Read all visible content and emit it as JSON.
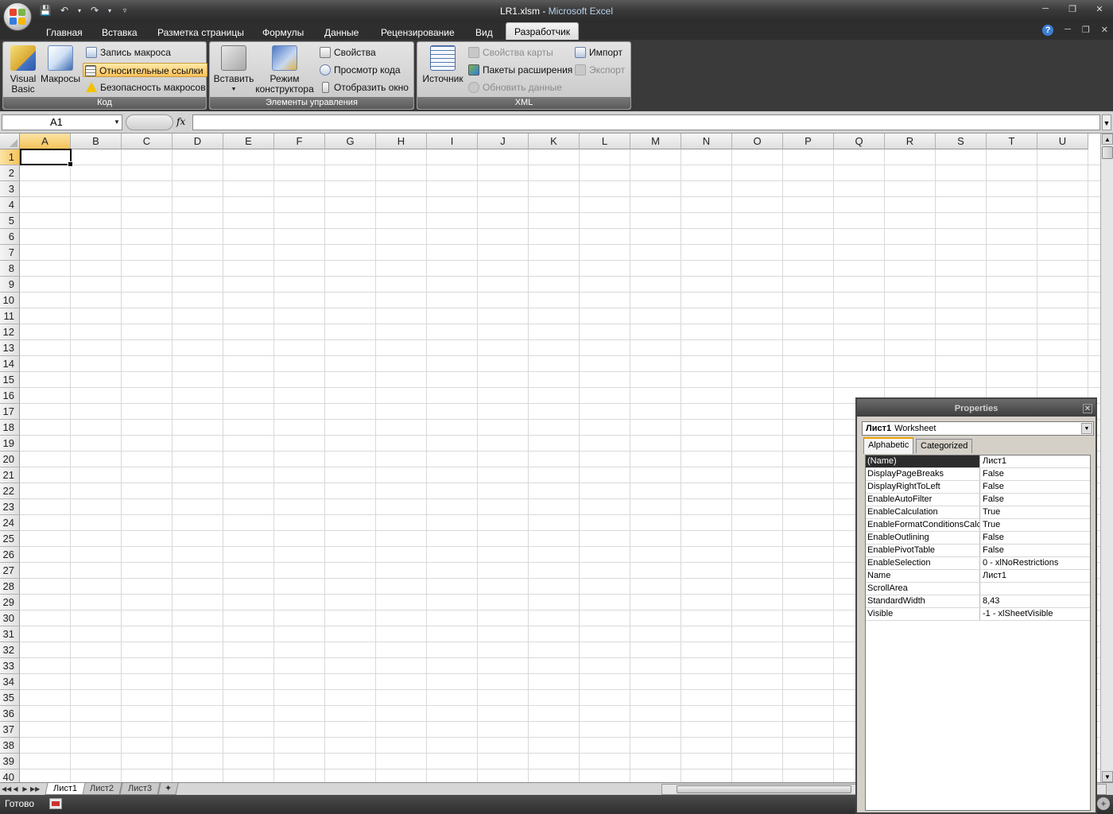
{
  "window": {
    "file": "LR1.xlsm",
    "separator": " - ",
    "app": "Microsoft Excel"
  },
  "tabs": [
    "Главная",
    "Вставка",
    "Разметка страницы",
    "Формулы",
    "Данные",
    "Рецензирование",
    "Вид",
    "Разработчик"
  ],
  "active_tab": "Разработчик",
  "ribbon": {
    "code": {
      "label": "Код",
      "visual_basic": "Visual Basic",
      "visual_basic_l1": "Visual",
      "visual_basic_l2": "Basic",
      "macros": "Макросы",
      "record_macro": "Запись макроса",
      "relative_refs": "Относительные ссылки",
      "macro_security": "Безопасность макросов"
    },
    "controls": {
      "label": "Элементы управления",
      "insert": "Вставить",
      "design_mode_l1": "Режим",
      "design_mode_l2": "конструктора",
      "properties": "Свойства",
      "view_code": "Просмотр кода",
      "show_window": "Отобразить окно"
    },
    "xml": {
      "label": "XML",
      "source": "Источник",
      "map_properties": "Свойства карты",
      "expansion_packs": "Пакеты расширения",
      "refresh_data": "Обновить данные",
      "import": "Импорт",
      "export": "Экспорт"
    }
  },
  "formula_bar": {
    "name_box": "A1",
    "fx": "fx",
    "formula": ""
  },
  "grid": {
    "columns": [
      "A",
      "B",
      "C",
      "D",
      "E",
      "F",
      "G",
      "H",
      "I",
      "J",
      "K",
      "L",
      "M",
      "N",
      "O",
      "P",
      "Q",
      "R",
      "S",
      "T",
      "U"
    ],
    "rows": [
      "1",
      "2",
      "3",
      "4",
      "5",
      "6",
      "7",
      "8",
      "9",
      "10",
      "11",
      "12",
      "13",
      "14",
      "15",
      "16",
      "17",
      "18",
      "19",
      "20",
      "21",
      "22",
      "23",
      "24",
      "25",
      "26",
      "27",
      "28",
      "29",
      "30",
      "31",
      "32",
      "33",
      "34",
      "35",
      "36",
      "37",
      "38",
      "39",
      "40"
    ],
    "active_cell": "A1"
  },
  "sheets": [
    "Лист1",
    "Лист2",
    "Лист3"
  ],
  "active_sheet": "Лист1",
  "status": {
    "text": "Готово"
  },
  "properties_panel": {
    "title": "Properties",
    "object_name": "Лист1",
    "object_type": "Worksheet",
    "tab_alphabetic": "Alphabetic",
    "tab_categorized": "Categorized",
    "rows": [
      {
        "key": "(Name)",
        "value": "Лист1"
      },
      {
        "key": "DisplayPageBreaks",
        "value": "False"
      },
      {
        "key": "DisplayRightToLeft",
        "value": "False"
      },
      {
        "key": "EnableAutoFilter",
        "value": "False"
      },
      {
        "key": "EnableCalculation",
        "value": "True"
      },
      {
        "key": "EnableFormatConditionsCalcu",
        "value": "True"
      },
      {
        "key": "EnableOutlining",
        "value": "False"
      },
      {
        "key": "EnablePivotTable",
        "value": "False"
      },
      {
        "key": "EnableSelection",
        "value": "0 - xlNoRestrictions"
      },
      {
        "key": "Name",
        "value": "Лист1"
      },
      {
        "key": "ScrollArea",
        "value": ""
      },
      {
        "key": "StandardWidth",
        "value": "8,43"
      },
      {
        "key": "Visible",
        "value": "-1 - xlSheetVisible"
      }
    ]
  },
  "colors": {
    "selection_header": "#f6c35a",
    "active_tab_accent": "#f2a400",
    "app_title_accent": "#b8d0f0"
  }
}
